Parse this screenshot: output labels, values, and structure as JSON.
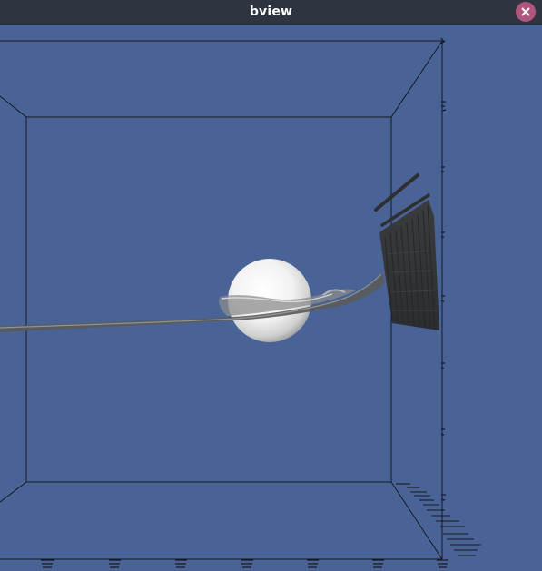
{
  "window": {
    "title": "bview",
    "close_icon": "close-icon",
    "accent": "#b0567c",
    "titlebar_color": "#2e3440"
  },
  "viewport": {
    "background": "#4a6396",
    "content": "3d-render"
  }
}
